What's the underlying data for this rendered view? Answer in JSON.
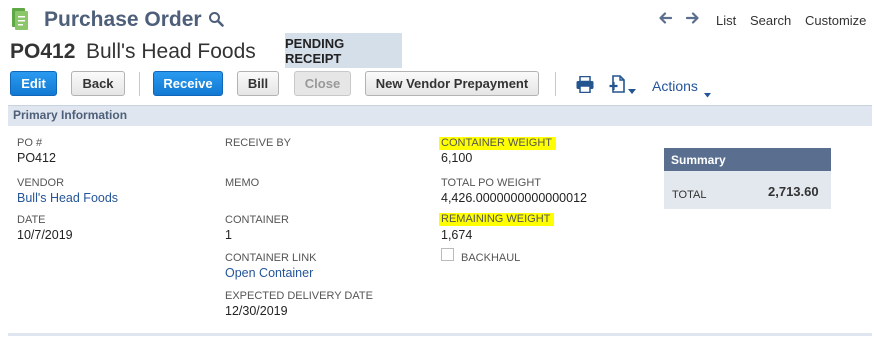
{
  "header": {
    "title": "Purchase Order",
    "icons": {
      "doc": "purchase-order-doc-icon",
      "search": "search-icon",
      "back": "arrow-left-icon",
      "forward": "arrow-right-icon"
    },
    "links": {
      "list": "List",
      "search": "Search",
      "customize": "Customize"
    }
  },
  "record": {
    "id": "PO412",
    "name": "Bull's Head Foods",
    "status": "PENDING RECEIPT"
  },
  "toolbar": {
    "edit": "Edit",
    "back": "Back",
    "receive": "Receive",
    "bill": "Bill",
    "close": "Close",
    "new_vendor_prepayment": "New Vendor Prepayment",
    "actions": "Actions",
    "icons": {
      "print": "print-icon",
      "new_doc": "new-document-icon"
    }
  },
  "section": {
    "title": "Primary Information"
  },
  "fields": {
    "po_number": {
      "label": "PO #",
      "value": "PO412"
    },
    "vendor": {
      "label": "VENDOR",
      "value": "Bull's Head Foods"
    },
    "date": {
      "label": "DATE",
      "value": "10/7/2019"
    },
    "receive_by": {
      "label": "RECEIVE BY",
      "value": ""
    },
    "memo": {
      "label": "MEMO",
      "value": ""
    },
    "container": {
      "label": "CONTAINER",
      "value": "1"
    },
    "container_link": {
      "label": "CONTAINER LINK",
      "value": "Open Container"
    },
    "expected_delivery_date": {
      "label": "EXPECTED DELIVERY DATE",
      "value": "12/30/2019"
    },
    "container_weight": {
      "label": "CONTAINER WEIGHT",
      "value": "6,100"
    },
    "total_po_weight": {
      "label": "TOTAL PO WEIGHT",
      "value": "4,426.0000000000000012"
    },
    "remaining_weight": {
      "label": "REMAINING WEIGHT",
      "value": "1,674"
    },
    "backhaul": {
      "label": "BACKHAUL",
      "checked": false
    }
  },
  "summary": {
    "title": "Summary",
    "total_label": "TOTAL",
    "total_value": "2,713.60"
  },
  "colors": {
    "primary_button": "#1a8ce0",
    "title_text": "#4d5f79",
    "link": "#255599",
    "highlight": "#ffff00",
    "status_badge_bg": "#d5dfe9",
    "section_bg": "#e0e6ef",
    "summary_header_bg": "#5a6f8f"
  }
}
